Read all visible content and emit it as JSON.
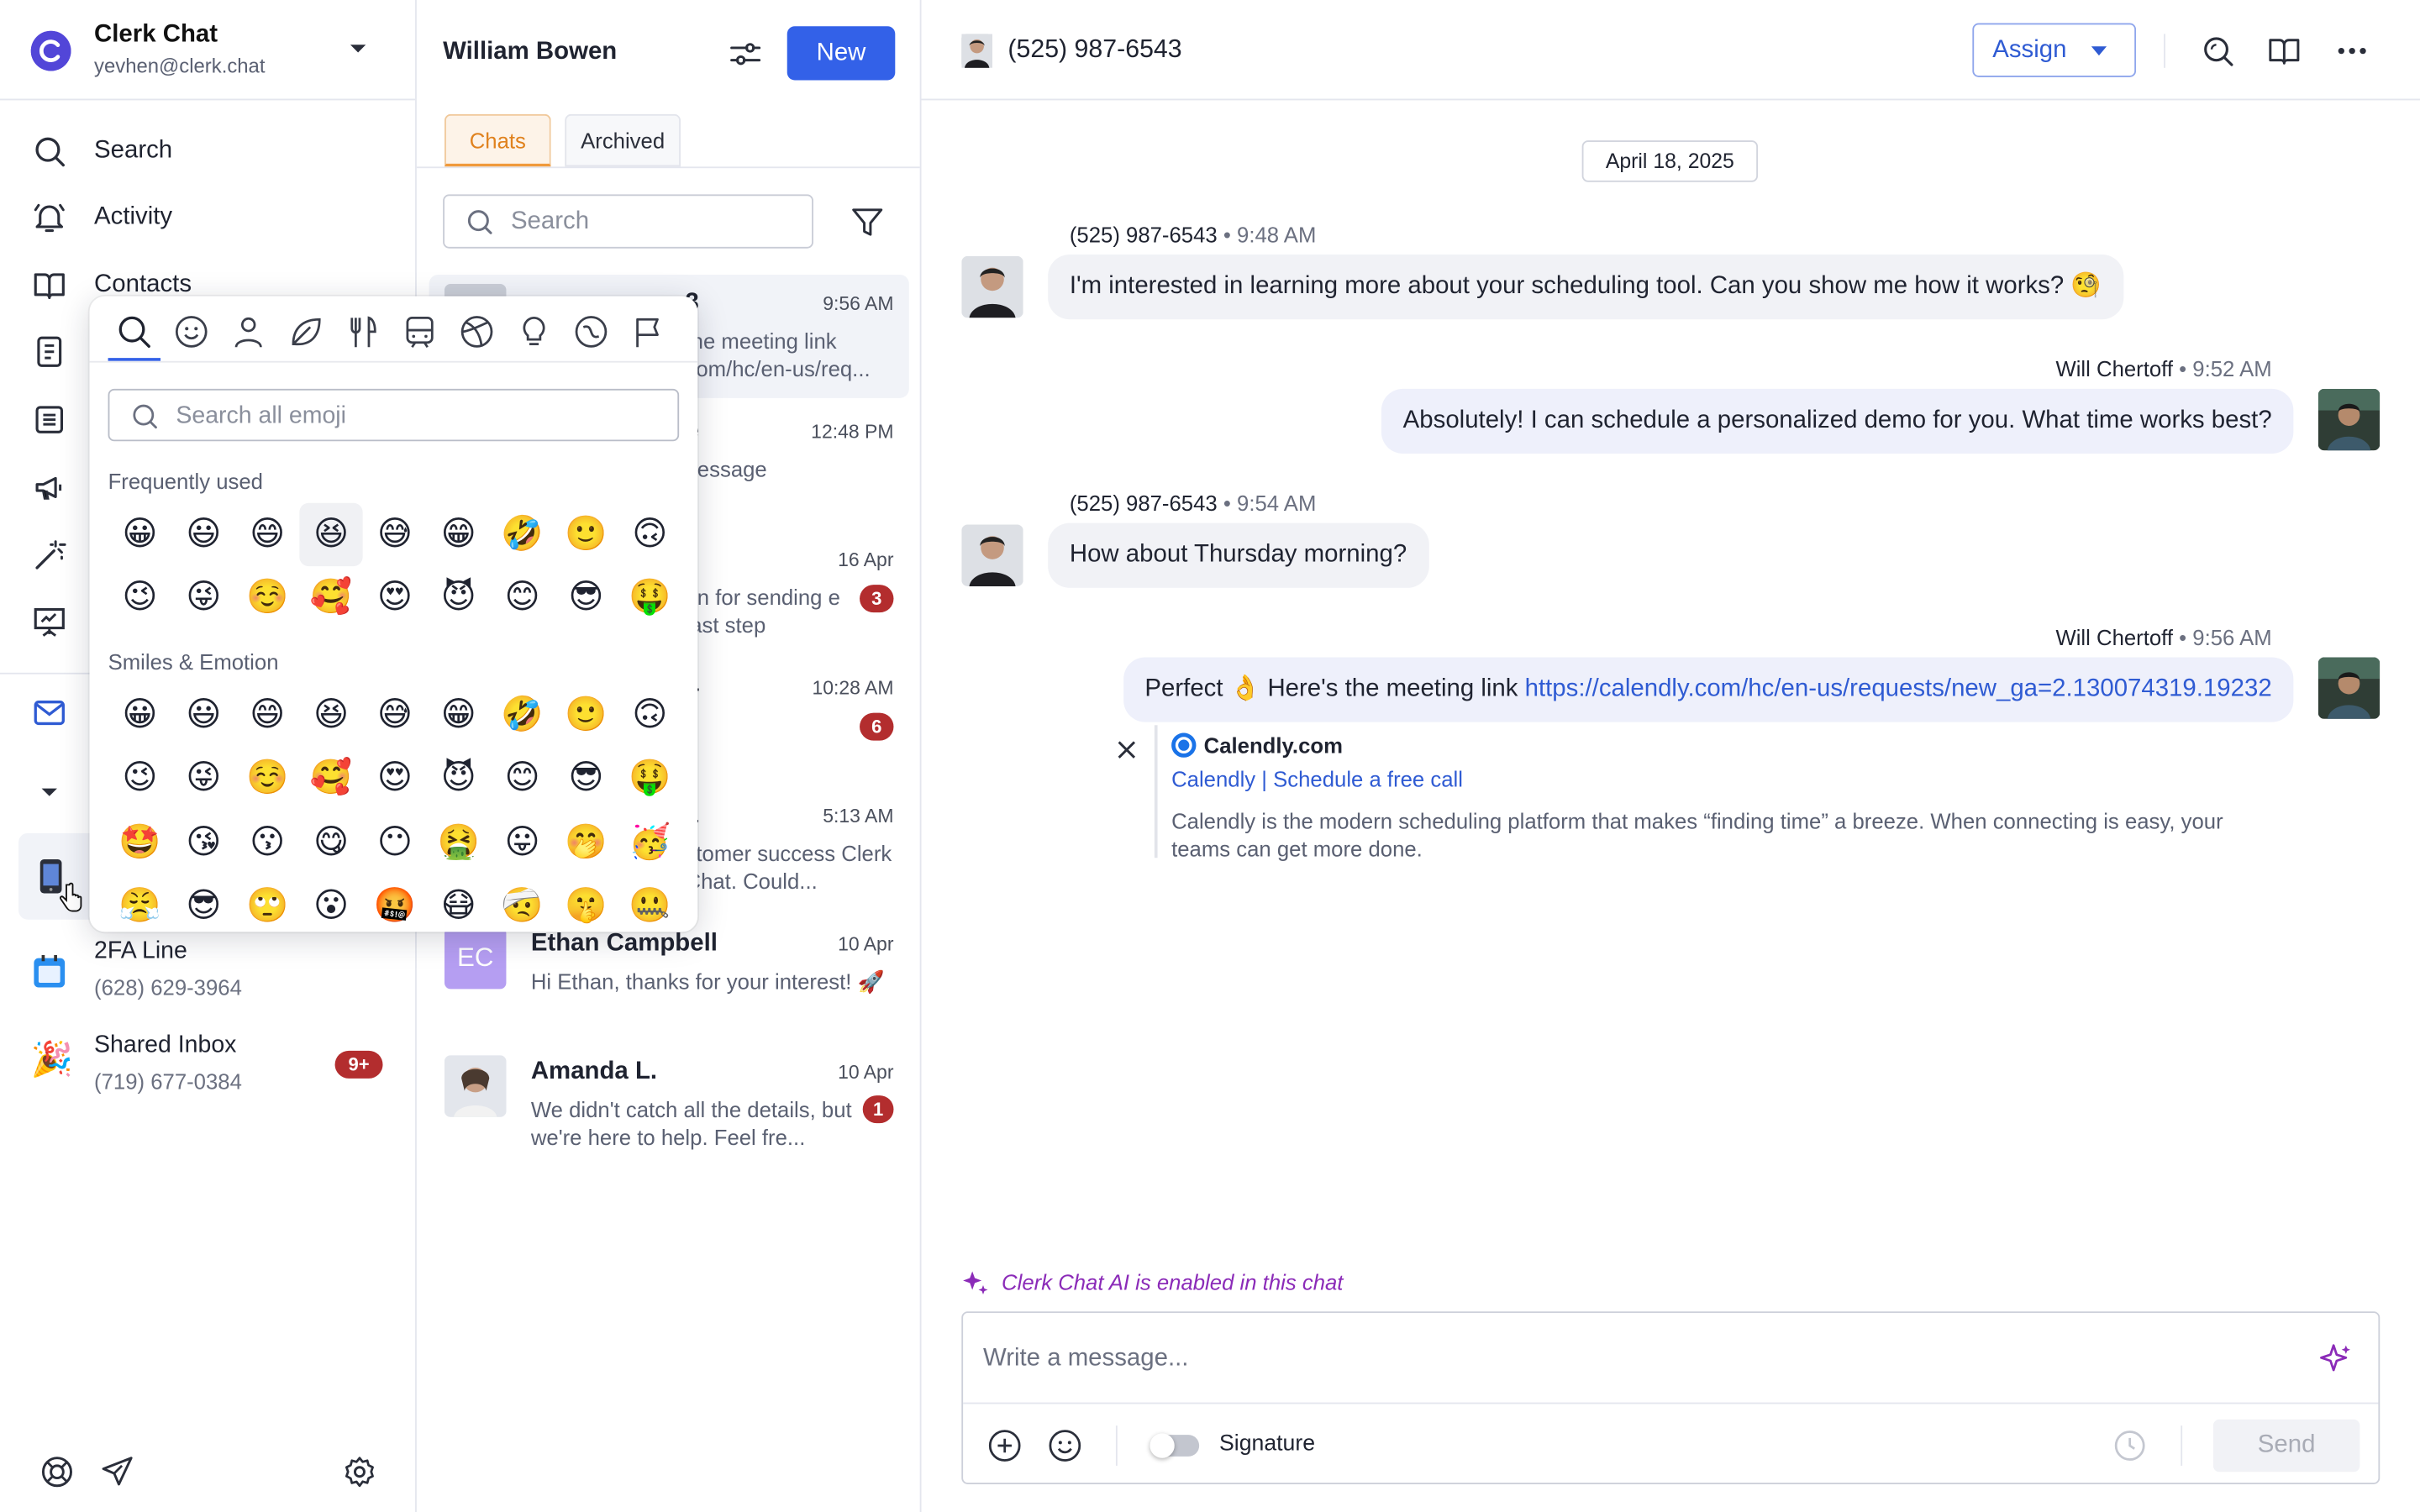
{
  "workspace": {
    "name": "Clerk Chat",
    "email": "yevhen@clerk.chat"
  },
  "nav": [
    {
      "label": "Search",
      "icon": "search-icon"
    },
    {
      "label": "Activity",
      "icon": "bell-icon"
    },
    {
      "label": "Contacts",
      "icon": "book-icon"
    }
  ],
  "sidebar_icons": [
    "document-icon",
    "list-icon",
    "megaphone-icon",
    "magic-wand-icon",
    "presentation-icon",
    "mail-icon"
  ],
  "inboxes": [
    {
      "name": "2FA Line",
      "number": "(628) 629-3964",
      "icon": "calendar-icon"
    },
    {
      "name": "Shared Inbox",
      "number": "(719) 677-0384",
      "badge": "9+",
      "icon": "party-icon"
    }
  ],
  "list": {
    "title": "William Bowen",
    "new_button": "New",
    "tabs": [
      "Chats",
      "Archived"
    ],
    "search_placeholder": "Search"
  },
  "chats": [
    {
      "name": "3",
      "time": "9:56 AM",
      "preview": "the meeting link com/hc/en-us/req..."
    },
    {
      "name": "e",
      "time": "12:48 PM",
      "preview": "nessage"
    },
    {
      "name": "",
      "time": "16 Apr",
      "preview": "on for sending e last step",
      "badge": "3"
    },
    {
      "name": "4",
      "time": "10:28 AM",
      "preview": "lf",
      "badge": "6"
    },
    {
      "name": "1",
      "time": "5:13 AM",
      "preview": "stomer success Clerk Chat. Could..."
    },
    {
      "name": "Ethan Campbell",
      "initials": "EC",
      "time": "10 Apr",
      "preview": "Hi Ethan, thanks for your interest! 🚀"
    },
    {
      "name": "Amanda L.",
      "time": "10 Apr",
      "preview": "We didn't catch all the details, but we're here to help. Feel fre...",
      "badge": "1"
    }
  ],
  "header": {
    "phone": "(525) 987-6543",
    "assign": "Assign"
  },
  "conversation": {
    "date": "April 18, 2025",
    "messages": [
      {
        "sender": "(525) 987-6543",
        "time": "9:48 AM",
        "text": "I'm interested in learning more about your scheduling tool. Can you show me how it works? 🧐"
      },
      {
        "sender": "Will Chertoff",
        "time": "9:52 AM",
        "text": "Absolutely! I can schedule a personalized demo for you. What time works best?"
      },
      {
        "sender": "(525) 987-6543",
        "time": "9:54 AM",
        "text": "How about Thursday morning?"
      },
      {
        "sender": "Will Chertoff",
        "time": "9:56 AM",
        "text_before": "Perfect 👌 Here's the meeting link ",
        "link": "https://calendly.com/hc/en-us/requests/new_ga=2.130074319.19232"
      }
    ],
    "link_preview": {
      "site": "Calendly.com",
      "title": "Calendly | Schedule a free call",
      "description": "Calendly is the modern scheduling platform that makes “finding time” a breeze. When connecting is easy, your teams can get more done."
    }
  },
  "composer": {
    "ai_notice": "Clerk Chat AI is enabled in this chat",
    "placeholder": "Write a message...",
    "signature": "Signature",
    "send": "Send"
  },
  "emoji_picker": {
    "search_placeholder": "Search all emoji",
    "sections": [
      {
        "title": "Frequently used",
        "emojis": [
          "😀",
          "😃",
          "😄",
          "😆",
          "😅",
          "😁",
          "🤣",
          "🙂",
          "🙃",
          "😉",
          "😜",
          "☺️",
          "🥰",
          "😍",
          "😈",
          "😊",
          "😎",
          "🤑"
        ]
      },
      {
        "title": "Smiles & Emotion",
        "emojis": [
          "😀",
          "😃",
          "😄",
          "😆",
          "😅",
          "😁",
          "🤣",
          "🙂",
          "🙃",
          "😉",
          "😜",
          "☺️",
          "🥰",
          "😍",
          "😈",
          "😊",
          "😎",
          "🤑",
          "🤩",
          "😘",
          "😗",
          "😋",
          "😶",
          "🤮",
          "😛",
          "🤭",
          "🥳",
          "😤",
          "😎",
          "🙄",
          "😮",
          "🤬",
          "😷",
          "🤕",
          "🤫",
          "🤐"
        ]
      }
    ],
    "categories": [
      "search-icon",
      "smiley-icon",
      "person-icon",
      "leaf-icon",
      "utensils-icon",
      "transport-icon",
      "ball-icon",
      "lightbulb-icon",
      "symbols-icon",
      "flag-icon"
    ]
  }
}
